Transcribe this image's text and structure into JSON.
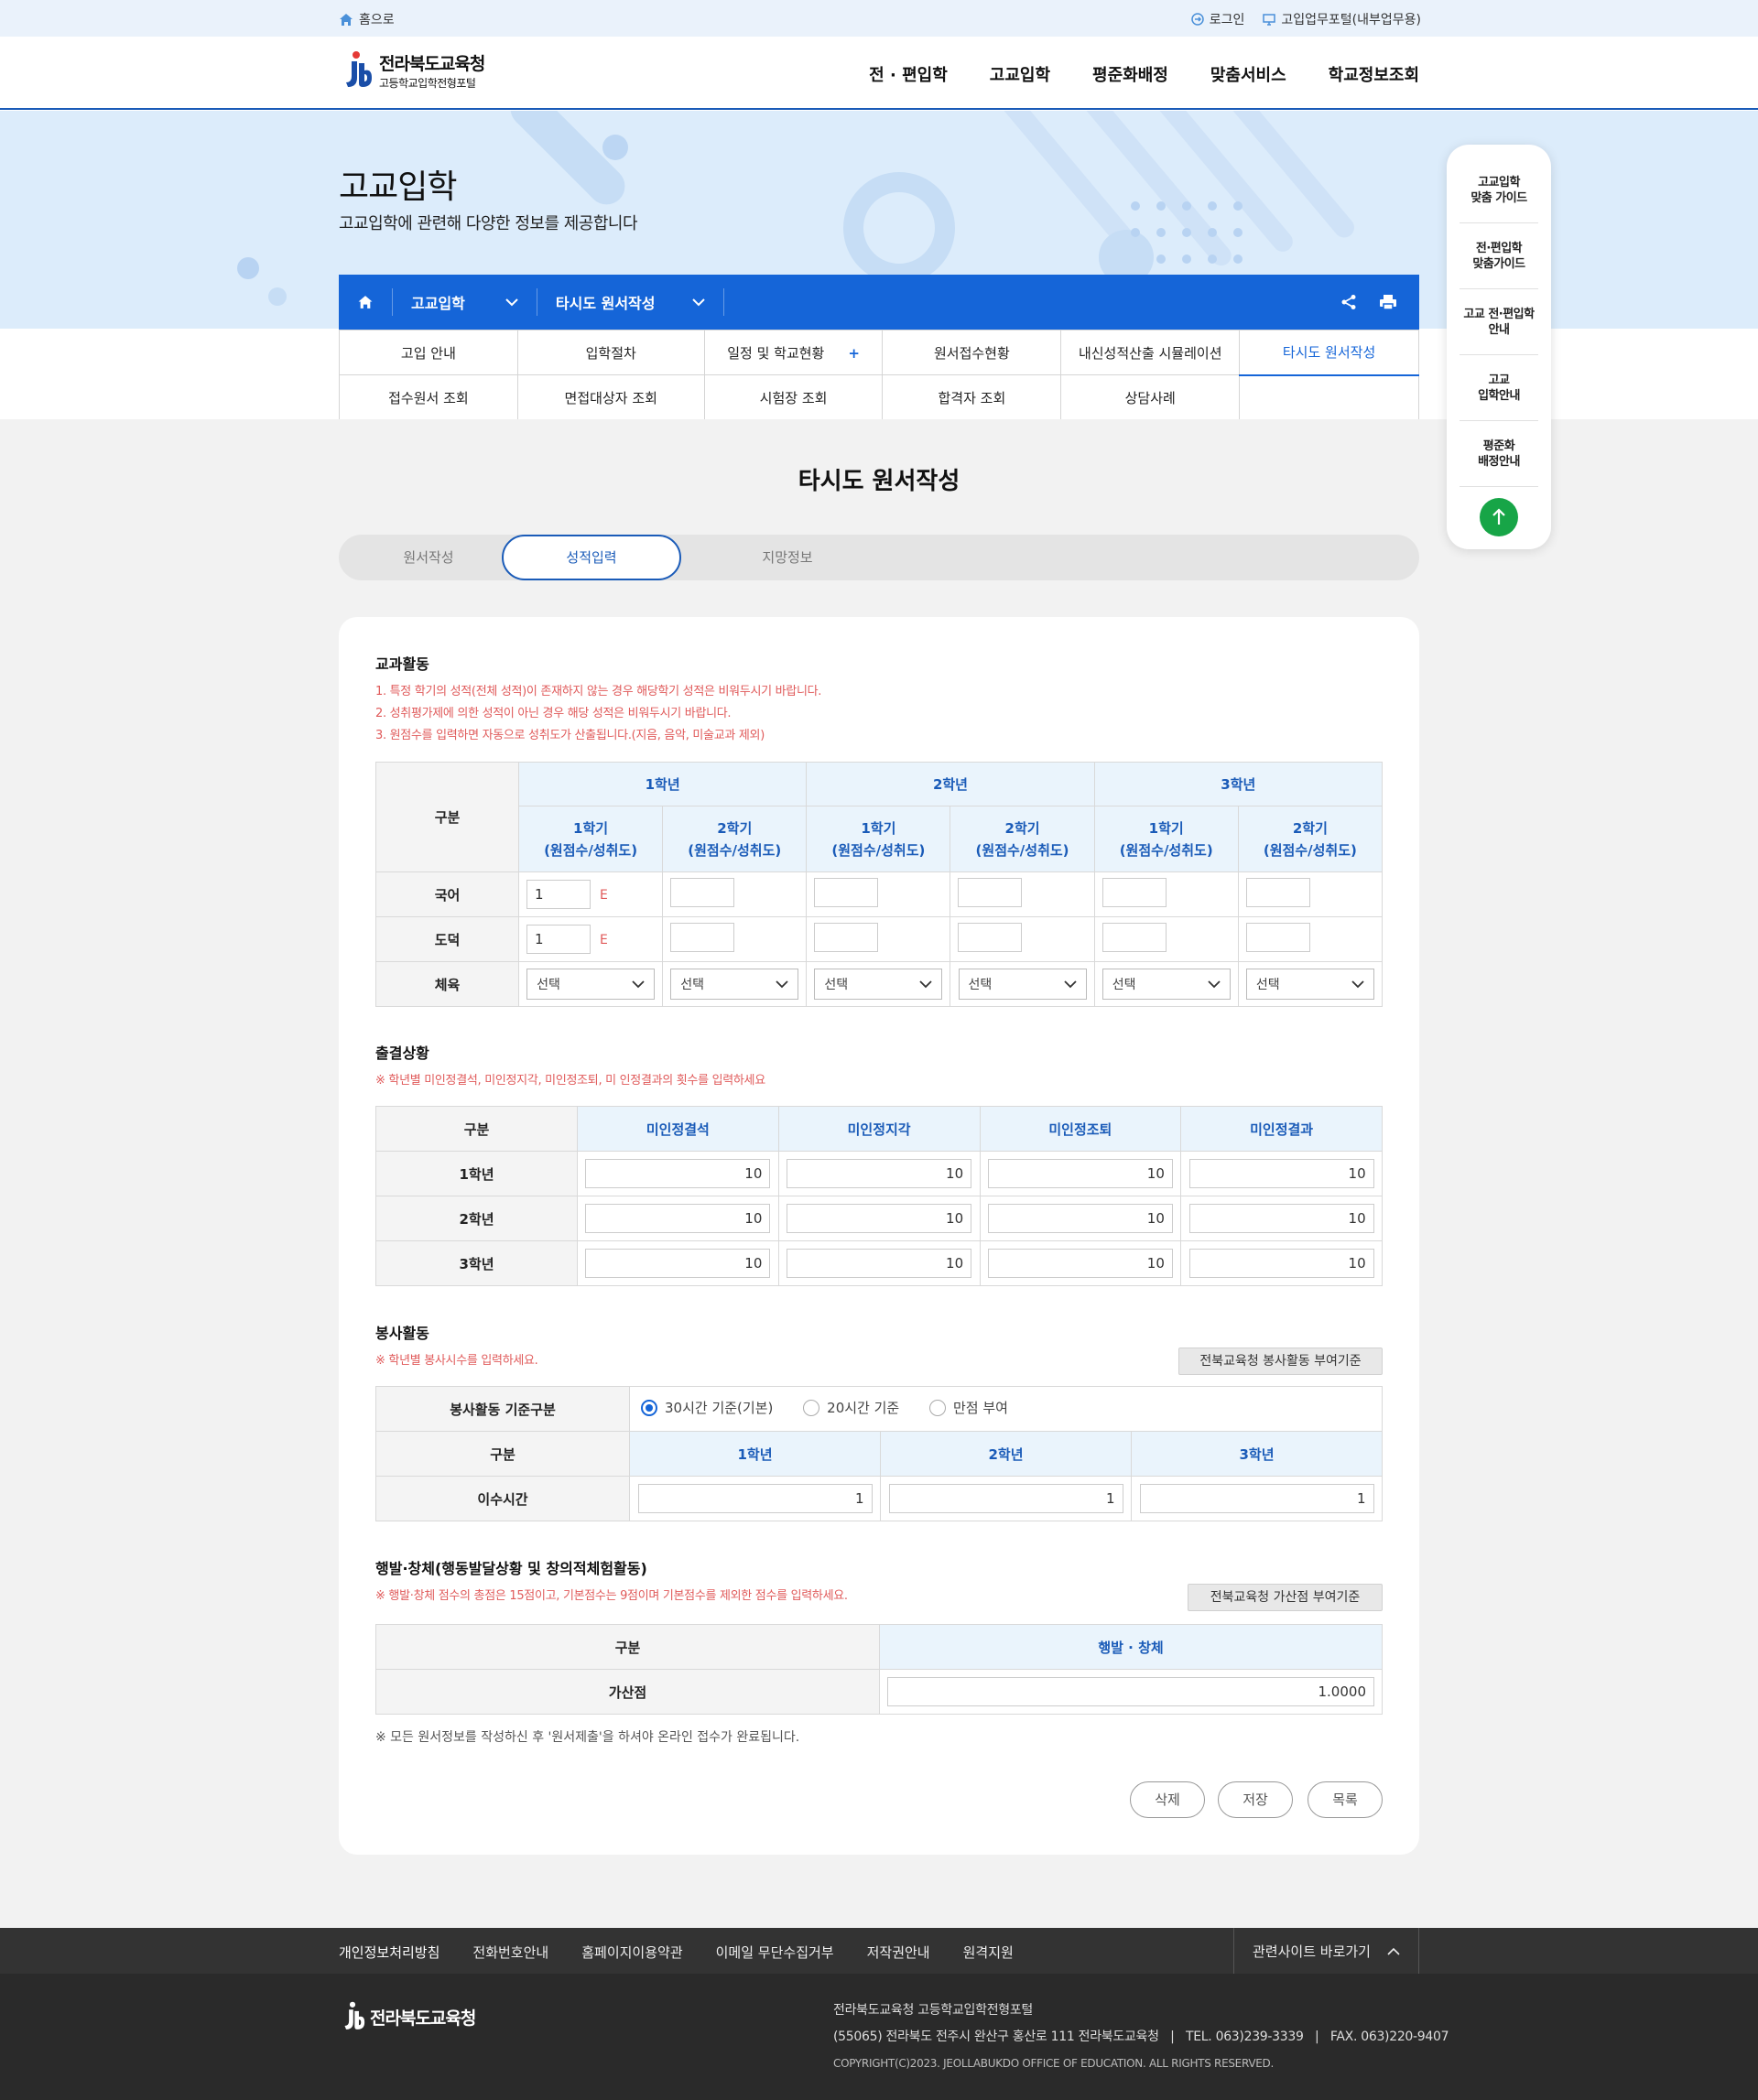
{
  "topbar": {
    "home": "홈으로",
    "login": "로그인",
    "portal": "고입업무포털(내부업무용)"
  },
  "logo": {
    "line1": "전라북도교육청",
    "line2": "고등학교입학전형포털"
  },
  "gnb": [
    "전 · 편입학",
    "고교입학",
    "평준화배정",
    "맞춤서비스",
    "학교정보조회"
  ],
  "hero": {
    "title": "고교입학",
    "subtitle": "고교입학에 관련해 다양한 정보를 제공합니다"
  },
  "location": {
    "depth1": "고교입학",
    "depth2": "타시도 원서작성"
  },
  "subnav": {
    "row1": [
      "고입 안내",
      "입학절차",
      "일정 및 학교현황",
      "원서접수현황",
      "내신성적산출 시뮬레이션",
      "타시도 원서작성"
    ],
    "row2": [
      "접수원서 조회",
      "면접대상자 조회",
      "시험장 조회",
      "합격자 조회",
      "상담사례",
      ""
    ]
  },
  "page_title": "타시도 원서작성",
  "steps": [
    "원서작성",
    "성적입력",
    "지망정보"
  ],
  "subjects": {
    "title": "교과활동",
    "notes": [
      "1. 특정 학기의 성적(전체 성적)이 존재하지 않는 경우 해당학기 성적은 비워두시기 바랍니다.",
      "2. 성취평가제에 의한 성적이 아닌 경우 해당 성적은 비워두시기 바랍니다.",
      "3. 원점수를 입력하면 자동으로 성취도가 산출됩니다.(지음, 음악, 미술교과 제외)"
    ],
    "col_group": "구분",
    "grades": [
      "1학년",
      "2학년",
      "3학년"
    ],
    "semester_label": "1학기",
    "semester_label2": "2학기",
    "semester_sub": "(원점수/성취도)",
    "rows": [
      {
        "name": "국어",
        "first": "1",
        "grade": "E"
      },
      {
        "name": "도덕",
        "first": "1",
        "grade": "E"
      },
      {
        "name": "체육",
        "select": "선택"
      }
    ]
  },
  "attendance": {
    "title": "출결상황",
    "note": "※ 학년별 미인정결석, 미인정지각, 미인정조퇴, 미 인정결과의 횟수를 입력하세요",
    "headers": [
      "구분",
      "미인정결석",
      "미인정지각",
      "미인정조퇴",
      "미인정결과"
    ],
    "rows": [
      {
        "label": "1학년",
        "values": [
          "10",
          "10",
          "10",
          "10"
        ]
      },
      {
        "label": "2학년",
        "values": [
          "10",
          "10",
          "10",
          "10"
        ]
      },
      {
        "label": "3학년",
        "values": [
          "10",
          "10",
          "10",
          "10"
        ]
      }
    ]
  },
  "volunteer": {
    "title": "봉사활동",
    "note": "※ 학년별 봉사시수를 입력하세요.",
    "button": "전북교육청 봉사활동 부여기준",
    "basis_label": "봉사활동 기준구분",
    "options": [
      "30시간 기준(기본)",
      "20시간 기준",
      "만점 부여"
    ],
    "headers": [
      "구분",
      "1학년",
      "2학년",
      "3학년"
    ],
    "row_label": "이수시간",
    "values": [
      "1",
      "1",
      "1"
    ]
  },
  "behavior": {
    "title": "행발·창체(행동발달상황 및 창의적체험활동)",
    "note": "※ 행발·창체 점수의 총점은 15점이고, 기본점수는 9점이며 기본점수를 제외한 점수를 입력하세요.",
    "button": "전북교육청 가산점 부여기준",
    "headers": [
      "구분",
      "행발 · 창체"
    ],
    "row_label": "가산점",
    "value": "1.0000"
  },
  "final_note": "※ 모든 원서정보를 작성하신 후 '원서제출'을 하셔야 온라인 접수가 완료됩니다.",
  "buttons": {
    "delete": "삭제",
    "save": "저장",
    "list": "목록"
  },
  "quick": [
    "고교입학\n맞춤 가이드",
    "전·편입학\n맞춤가이드",
    "고교 전·편입학\n안내",
    "고교\n입학안내",
    "평준화\n배정안내"
  ],
  "footer": {
    "links": [
      "개인정보처리방침",
      "전화번호안내",
      "홈페이지이용약관",
      "이메일 무단수집거부",
      "저작권안내",
      "원격지원"
    ],
    "related": "관련사이트 바로가기",
    "logo": "전라북도교육청",
    "org": "전라북도교육청 고등학교입학전형포털",
    "address": "(55065) 전라북도 전주시 완산구 홍산로 111 전라북도교육청   |   TEL. 063)239-3339   |   FAX. 063)220-9407",
    "copyright": "COPYRIGHT(C)2023. JEOLLABUKDO OFFICE OF EDUCATION. ALL RIGHTS RESERVED."
  },
  "colors": {
    "primary": "#1565d8",
    "accent_red": "#e05a5a",
    "quick_top": "#17a547"
  }
}
